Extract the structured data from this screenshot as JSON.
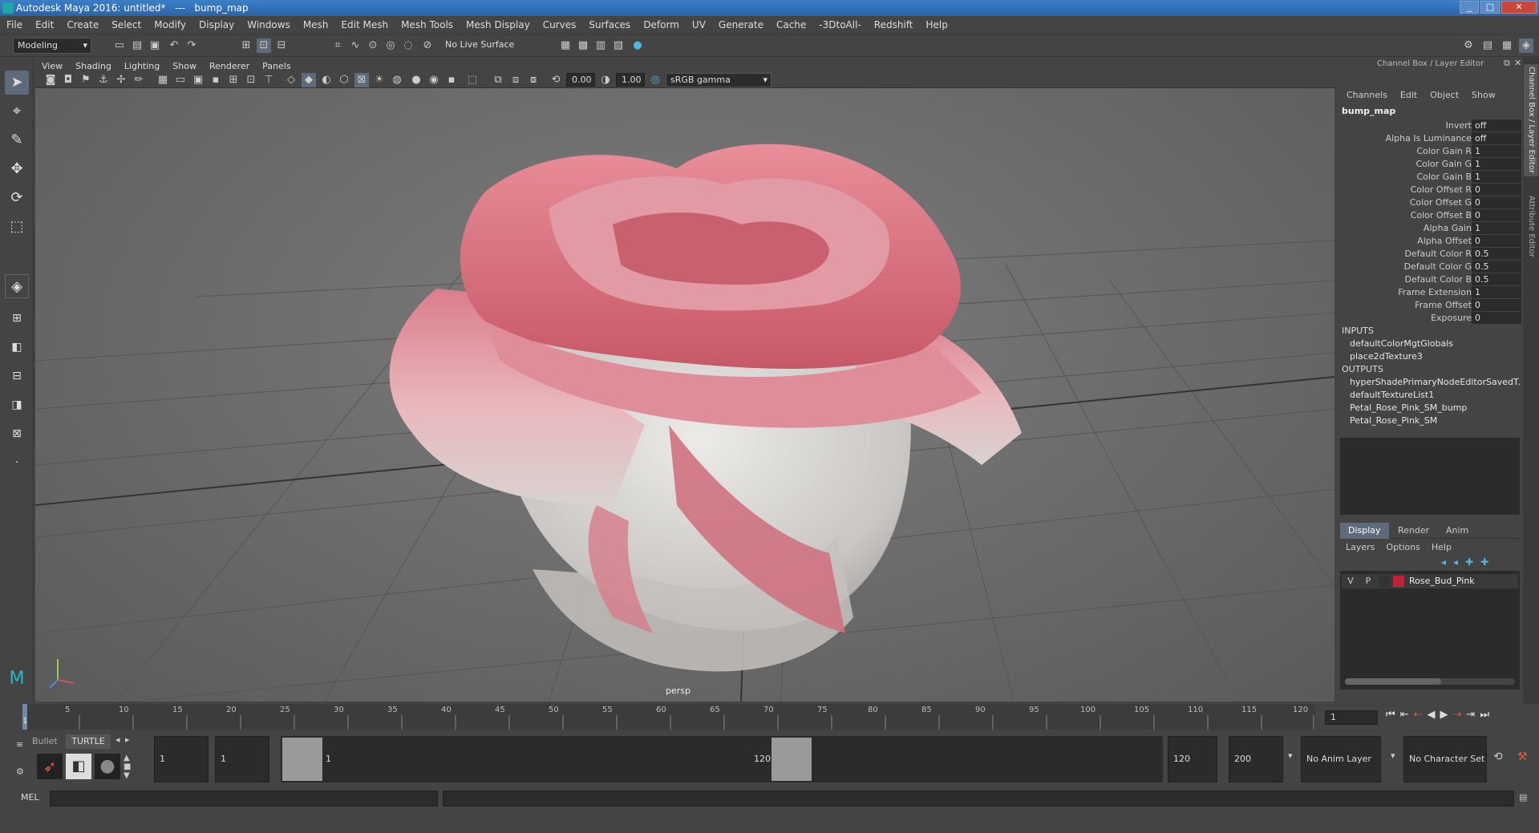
{
  "window": {
    "title": "Autodesk Maya 2016: untitled*   ---   bump_map",
    "min": "_",
    "max": "□",
    "close": "✕"
  },
  "menus": [
    "File",
    "Edit",
    "Create",
    "Select",
    "Modify",
    "Display",
    "Windows",
    "Mesh",
    "Edit Mesh",
    "Mesh Tools",
    "Mesh Display",
    "Curves",
    "Surfaces",
    "Deform",
    "UV",
    "Generate",
    "Cache",
    "-3DtoAll-",
    "Redshift",
    "Help"
  ],
  "status": {
    "mode": "Modeling",
    "live_surface": "No Live Surface"
  },
  "panel": {
    "menus": [
      "View",
      "Shading",
      "Lighting",
      "Show",
      "Renderer",
      "Panels"
    ],
    "field_a": "0.00",
    "field_b": "1.00",
    "color_space": "sRGB gamma",
    "camera": "persp"
  },
  "channel_box": {
    "header": "Channel Box / Layer Editor",
    "menus": [
      "Channels",
      "Edit",
      "Object",
      "Show"
    ],
    "node": "bump_map",
    "attributes": [
      {
        "name": "Invert",
        "value": "off"
      },
      {
        "name": "Alpha Is Luminance",
        "value": "off"
      },
      {
        "name": "Color Gain R",
        "value": "1"
      },
      {
        "name": "Color Gain G",
        "value": "1"
      },
      {
        "name": "Color Gain B",
        "value": "1"
      },
      {
        "name": "Color Offset R",
        "value": "0"
      },
      {
        "name": "Color Offset G",
        "value": "0"
      },
      {
        "name": "Color Offset B",
        "value": "0"
      },
      {
        "name": "Alpha Gain",
        "value": "1"
      },
      {
        "name": "Alpha Offset",
        "value": "0"
      },
      {
        "name": "Default Color R",
        "value": "0.5"
      },
      {
        "name": "Default Color G",
        "value": "0.5"
      },
      {
        "name": "Default Color B",
        "value": "0.5"
      },
      {
        "name": "Frame Extension",
        "value": "1"
      },
      {
        "name": "Frame Offset",
        "value": "0"
      },
      {
        "name": "Exposure",
        "value": "0"
      }
    ],
    "inputs_label": "INPUTS",
    "inputs": [
      "defaultColorMgtGlobals",
      "place2dTexture3"
    ],
    "outputs_label": "OUTPUTS",
    "outputs": [
      "hyperShadePrimaryNodeEditorSavedT...",
      "defaultTextureList1",
      "Petal_Rose_Pink_SM_bump",
      "Petal_Rose_Pink_SM"
    ]
  },
  "layer_editor": {
    "tabs": [
      "Display",
      "Render",
      "Anim"
    ],
    "menus": [
      "Layers",
      "Options",
      "Help"
    ],
    "layer": {
      "v": "V",
      "p": "P",
      "name": "Rose_Bud_Pink",
      "color": "#c4203a"
    }
  },
  "side_tabs": [
    "Channel Box / Layer Editor",
    "Attribute Editor"
  ],
  "timeline": {
    "ticks": [
      "1",
      "5",
      "10",
      "15",
      "20",
      "25",
      "30",
      "35",
      "40",
      "45",
      "50",
      "55",
      "60",
      "65",
      "70",
      "75",
      "80",
      "85",
      "90",
      "95",
      "100",
      "105",
      "110",
      "115",
      "120"
    ],
    "current_frame": "1"
  },
  "range": {
    "shelf_tabs": [
      "Bullet",
      "TURTLE"
    ],
    "start": "1",
    "inner_start": "1",
    "slider_start": "1",
    "slider_end": "120",
    "inner_end": "120",
    "end": "200",
    "anim_layer": "No Anim Layer",
    "char_set": "No Character Set"
  },
  "command": {
    "label": "MEL"
  }
}
